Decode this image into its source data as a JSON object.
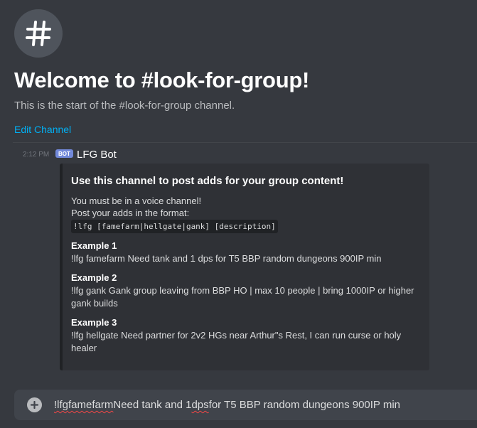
{
  "welcome": {
    "icon": "hashtag-icon",
    "title": "Welcome to #look-for-group!",
    "subtitle": "This is the start of the #look-for-group channel.",
    "edit_channel": "Edit Channel"
  },
  "message": {
    "timestamp": "2:12 PM",
    "bot_tag": "BOT",
    "author": "LFG Bot",
    "embed": {
      "title": "Use this channel to post adds for your group content!",
      "desc_line1": "You must be in a voice channel!",
      "desc_line2": "Post your adds in the format:",
      "format_code": "!lfg [famefarm|hellgate|gank] [description]",
      "fields": [
        {
          "name": "Example 1",
          "value": "!lfg famefarm Need tank and 1 dps for T5 BBP random dungeons 900IP min"
        },
        {
          "name": "Example 2",
          "value": "!lfg gank Gank group leaving from BBP HO | max 10 people | bring 1000IP or higher gank builds"
        },
        {
          "name": "Example 3",
          "value": "!lfg hellgate Need partner for 2v2 HGs near Arthur\"s Rest, I can run curse or holy healer"
        }
      ]
    }
  },
  "composer": {
    "plus_icon": "plus-circle-icon",
    "value_part1": "!lfg",
    "value_part2": " ",
    "value_part3": "famefarm",
    "value_part4": " Need tank and 1 ",
    "value_part5": "dps",
    "value_part6": " for T5 BBP random dungeons 900IP min"
  },
  "colors": {
    "background": "#36393f",
    "embed_bg": "#2f3136",
    "link": "#00b0f4",
    "bot_tag": "#7289da",
    "composer_bg": "#40444b"
  }
}
